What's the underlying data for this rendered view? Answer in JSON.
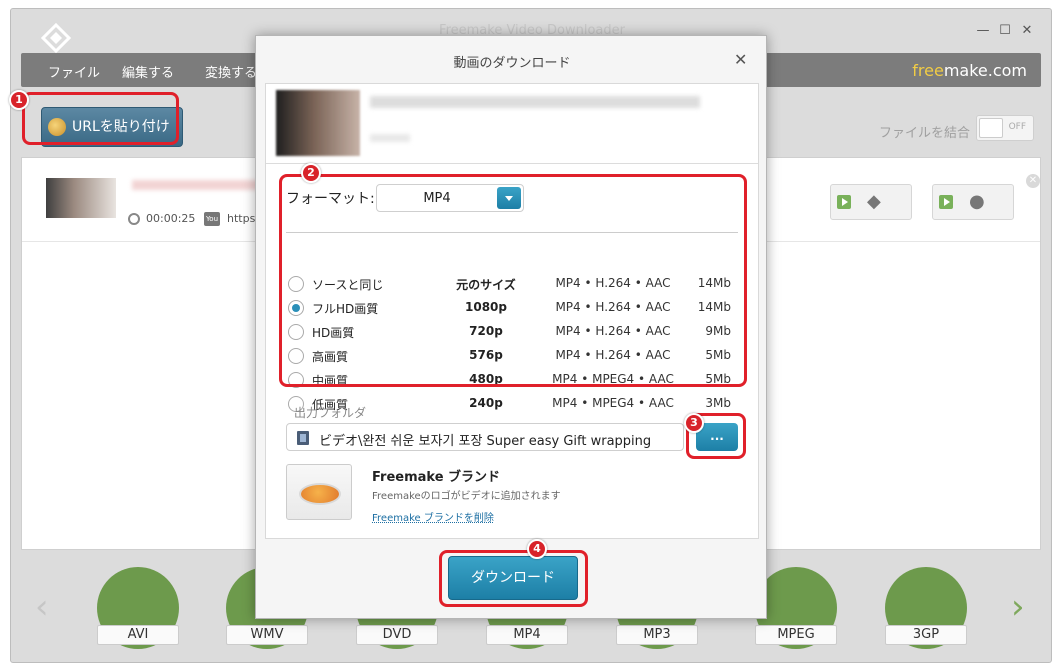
{
  "window": {
    "title": "Freemake Video Downloader",
    "controls": {
      "minimize": "—",
      "maximize": "☐",
      "close": "✕"
    }
  },
  "menu": {
    "items": [
      "ファイル",
      "編集する",
      "変換する"
    ],
    "brand_prefix": "free",
    "brand_suffix": "make.com"
  },
  "toolbar": {
    "paste_url_label": "URLを貼り付ける",
    "merge_files_label": "ファイルを結合",
    "merge_toggle_state": "OFF"
  },
  "list": {
    "items": [
      {
        "duration": "00:00:25",
        "source_icon": "You Tube",
        "url": "https://"
      }
    ]
  },
  "formats": {
    "items": [
      "AVI",
      "WMV",
      "DVD",
      "MP4",
      "MP3",
      "MPEG",
      "3GP"
    ]
  },
  "dialog": {
    "title": "動画のダウンロード",
    "close_symbol": "✕",
    "format_label": "フォーマット:",
    "format_value": "MP4",
    "qualities": [
      {
        "name": "ソースと同じ",
        "resolution": "元のサイズ",
        "codec": "MP4 • H.264 • AAC",
        "size": "14Mb",
        "selected": false
      },
      {
        "name": "フルHD画質",
        "resolution": "1080p",
        "codec": "MP4 • H.264 • AAC",
        "size": "14Mb",
        "selected": true
      },
      {
        "name": "HD画質",
        "resolution": "720p",
        "codec": "MP4 • H.264 • AAC",
        "size": "9Mb",
        "selected": false
      },
      {
        "name": "高画質",
        "resolution": "576p",
        "codec": "MP4 • H.264 • AAC",
        "size": "5Mb",
        "selected": false
      },
      {
        "name": "中画質",
        "resolution": "480p",
        "codec": "MP4 • MPEG4 • AAC",
        "size": "5Mb",
        "selected": false
      },
      {
        "name": "低画質",
        "resolution": "240p",
        "codec": "MP4 • MPEG4 • AAC",
        "size": "3Mb",
        "selected": false
      }
    ],
    "output_folder_label": "出力フォルダ",
    "output_path": "ビデオ\\완전 쉬운 보자기 포장  Super easy Gift wrapping",
    "browse_label": "...",
    "brand": {
      "title": "Freemake ブランド",
      "description": "Freemakeのロゴがビデオに追加されます",
      "remove_link": "Freemake ブランドを削除"
    },
    "download_label": "ダウンロード"
  },
  "annotations": {
    "badges": [
      "1",
      "2",
      "3",
      "4"
    ],
    "highlight_color": "#e0202a"
  },
  "colors": {
    "accent": "#1d7fa6",
    "menubar": "#7c7c7c",
    "format_circle": "#6d9a4c"
  }
}
